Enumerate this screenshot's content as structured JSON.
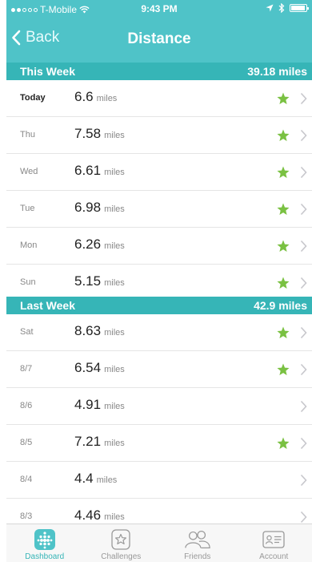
{
  "status": {
    "carrier": "T-Mobile",
    "time": "9:43 PM"
  },
  "nav": {
    "back_label": "Back",
    "title": "Distance"
  },
  "this_week": {
    "label": "This Week",
    "total": "39.18 miles",
    "rows": [
      {
        "day": "Today",
        "value": "6.6",
        "unit": "miles",
        "star": true
      },
      {
        "day": "Thu",
        "value": "7.58",
        "unit": "miles",
        "star": true
      },
      {
        "day": "Wed",
        "value": "6.61",
        "unit": "miles",
        "star": true
      },
      {
        "day": "Tue",
        "value": "6.98",
        "unit": "miles",
        "star": true
      },
      {
        "day": "Mon",
        "value": "6.26",
        "unit": "miles",
        "star": true
      },
      {
        "day": "Sun",
        "value": "5.15",
        "unit": "miles",
        "star": true
      }
    ]
  },
  "last_week": {
    "label": "Last Week",
    "total": "42.9 miles",
    "rows": [
      {
        "day": "Sat",
        "value": "8.63",
        "unit": "miles",
        "star": true
      },
      {
        "day": "8/7",
        "value": "6.54",
        "unit": "miles",
        "star": true
      },
      {
        "day": "8/6",
        "value": "4.91",
        "unit": "miles",
        "star": false
      },
      {
        "day": "8/5",
        "value": "7.21",
        "unit": "miles",
        "star": true
      },
      {
        "day": "8/4",
        "value": "4.4",
        "unit": "miles",
        "star": false
      },
      {
        "day": "8/3",
        "value": "4.46",
        "unit": "miles",
        "star": false
      }
    ]
  },
  "tabs": [
    {
      "label": "Dashboard",
      "icon": "dashboard-icon",
      "active": true
    },
    {
      "label": "Challenges",
      "icon": "challenges-icon",
      "active": false
    },
    {
      "label": "Friends",
      "icon": "friends-icon",
      "active": false
    },
    {
      "label": "Account",
      "icon": "account-icon",
      "active": false
    }
  ],
  "colors": {
    "header": "#4fc3c8",
    "section": "#36b5b7",
    "star": "#7ac142",
    "chevron": "#c7c7cc"
  }
}
